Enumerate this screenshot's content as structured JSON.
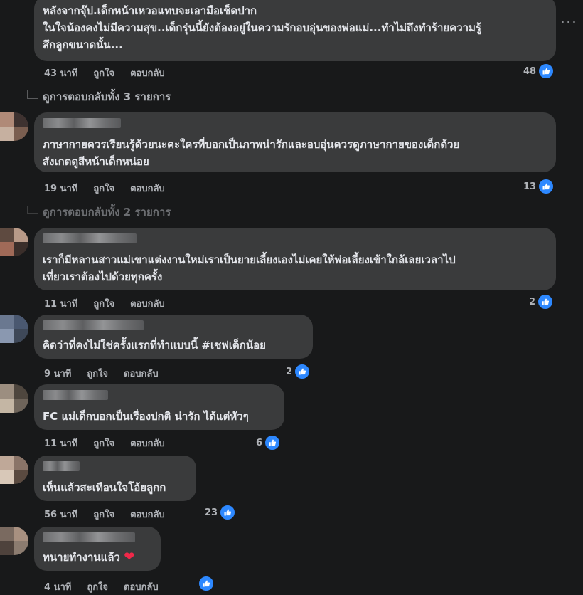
{
  "more_label": "···",
  "comments": [
    {
      "text": [
        "หลังจากจุ๊ป.เด็กหน้าเหวอแทบจะเอามือเช็ดปาก",
        "ในใจน้องคงไม่มีความสุข..เด็กรุ่นนี้ยังต้องอยู่ในความรักอบอุ่นของพ่อแม่...ทำไม่ถึงทำร้ายความรู้",
        "สึกลูกขนาดนั้น..."
      ],
      "time": "43 นาที",
      "like": "ถูกใจ",
      "reply": "ตอบกลับ",
      "reactions": "48"
    },
    {
      "text": [
        "ภาษากายควรเรียนรู้ด้วยนะคะใครที่บอกเป็นภาพน่ารักและอบอุ่นควรดูภาษากายของเด็กด้วย",
        "สังเกตดูสีหน้าเด็กหน่อย"
      ],
      "time": "19 นาที",
      "like": "ถูกใจ",
      "reply": "ตอบกลับ",
      "reactions": "13"
    },
    {
      "text": [
        "เราก็มีหลานสาวแม่เขาแต่งงานใหม่เราเป็นยายเลี้ยงเองไม่เคยให้พ่อเลี้ยงเข้าใกล้เลยเวลาไป",
        "เที่ยวเราต้องไปด้วยทุกครั้ง"
      ],
      "time": "11 นาที",
      "like": "ถูกใจ",
      "reply": "ตอบกลับ",
      "reactions": "2"
    },
    {
      "text": [
        "คิดว่าที่คงไม่ใช่ครั้งแรกที่ทำแบบนี้ #เชฟเด็กน้อย"
      ],
      "time": "9 นาที",
      "like": "ถูกใจ",
      "reply": "ตอบกลับ",
      "reactions": "2"
    },
    {
      "text": [
        "FC แม่เด็กบอกเป็นเรื่องปกติ น่ารัก ได้แต่หัวๆ"
      ],
      "time": "11 นาที",
      "like": "ถูกใจ",
      "reply": "ตอบกลับ",
      "reactions": "6"
    },
    {
      "text": [
        "เห็นแล้วสะเทือนใจโอ้ยลูกก"
      ],
      "time": "56 นาที",
      "like": "ถูกใจ",
      "reply": "ตอบกลับ",
      "reactions": "23"
    },
    {
      "text": [
        "ทนายทำงานแล้ว"
      ],
      "heart": "❤",
      "time": "4 นาที",
      "like": "ถูกใจ",
      "reply": "ตอบกลับ",
      "reactions": ""
    }
  ],
  "view_replies": [
    "ดูการตอบกลับทั้ง 3 รายการ",
    "ดูการตอบกลับทั้ง 2 รายการ"
  ],
  "colors": {
    "background": "#18191a",
    "bubble": "#3a3b3c",
    "text": "#e4e6eb",
    "meta": "#b0b3b8",
    "like_blue": "#2d88ff",
    "heart": "#f02849"
  }
}
